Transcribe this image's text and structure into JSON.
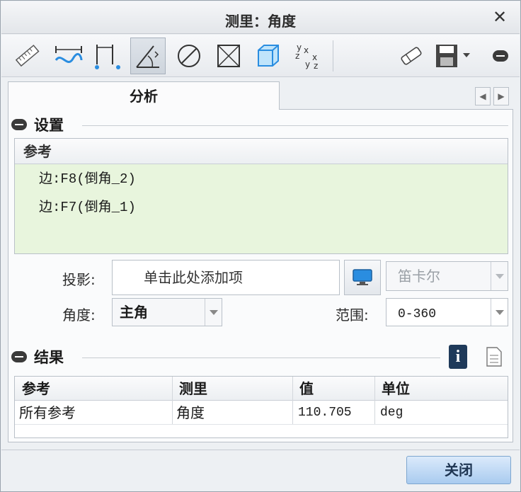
{
  "window": {
    "title": "测里：角度"
  },
  "toolbar": {
    "icons": [
      "length-ruler-icon",
      "curve-length-icon",
      "distance-icon",
      "angle-icon",
      "diameter-icon",
      "transform-icon",
      "volume-icon",
      "coordinate-transform-icon",
      "eraser-icon",
      "save-icon",
      "collapse-icon"
    ],
    "active": "angle-icon"
  },
  "tabs": {
    "analysis": "分析"
  },
  "setup": {
    "title": "设置",
    "references_header": "参考",
    "references": [
      {
        "prefix": "边",
        "text": ":F8(",
        "feature": "倒角",
        "suffix": "_2)"
      },
      {
        "prefix": "边",
        "text": ":F7(",
        "feature": "倒角",
        "suffix": "_1)"
      }
    ],
    "projection_label": "投影:",
    "projection_placeholder": "单击此处添加项",
    "coord_system": "笛卡尔",
    "angle_label": "角度:",
    "angle_value": "主角",
    "range_label": "范围:",
    "range_value": "0-360"
  },
  "results": {
    "title": "结果",
    "columns": [
      "参考",
      "测里",
      "值",
      "单位"
    ],
    "rows": [
      {
        "reference": "所有参考",
        "measure": "角度",
        "value": "110.705",
        "unit": "deg"
      }
    ]
  },
  "footer": {
    "close_label": "关闭"
  },
  "colors": {
    "accent": "#1f3a5a",
    "ref_bg": "#e8f5dd",
    "info": "#1f3a5a"
  }
}
